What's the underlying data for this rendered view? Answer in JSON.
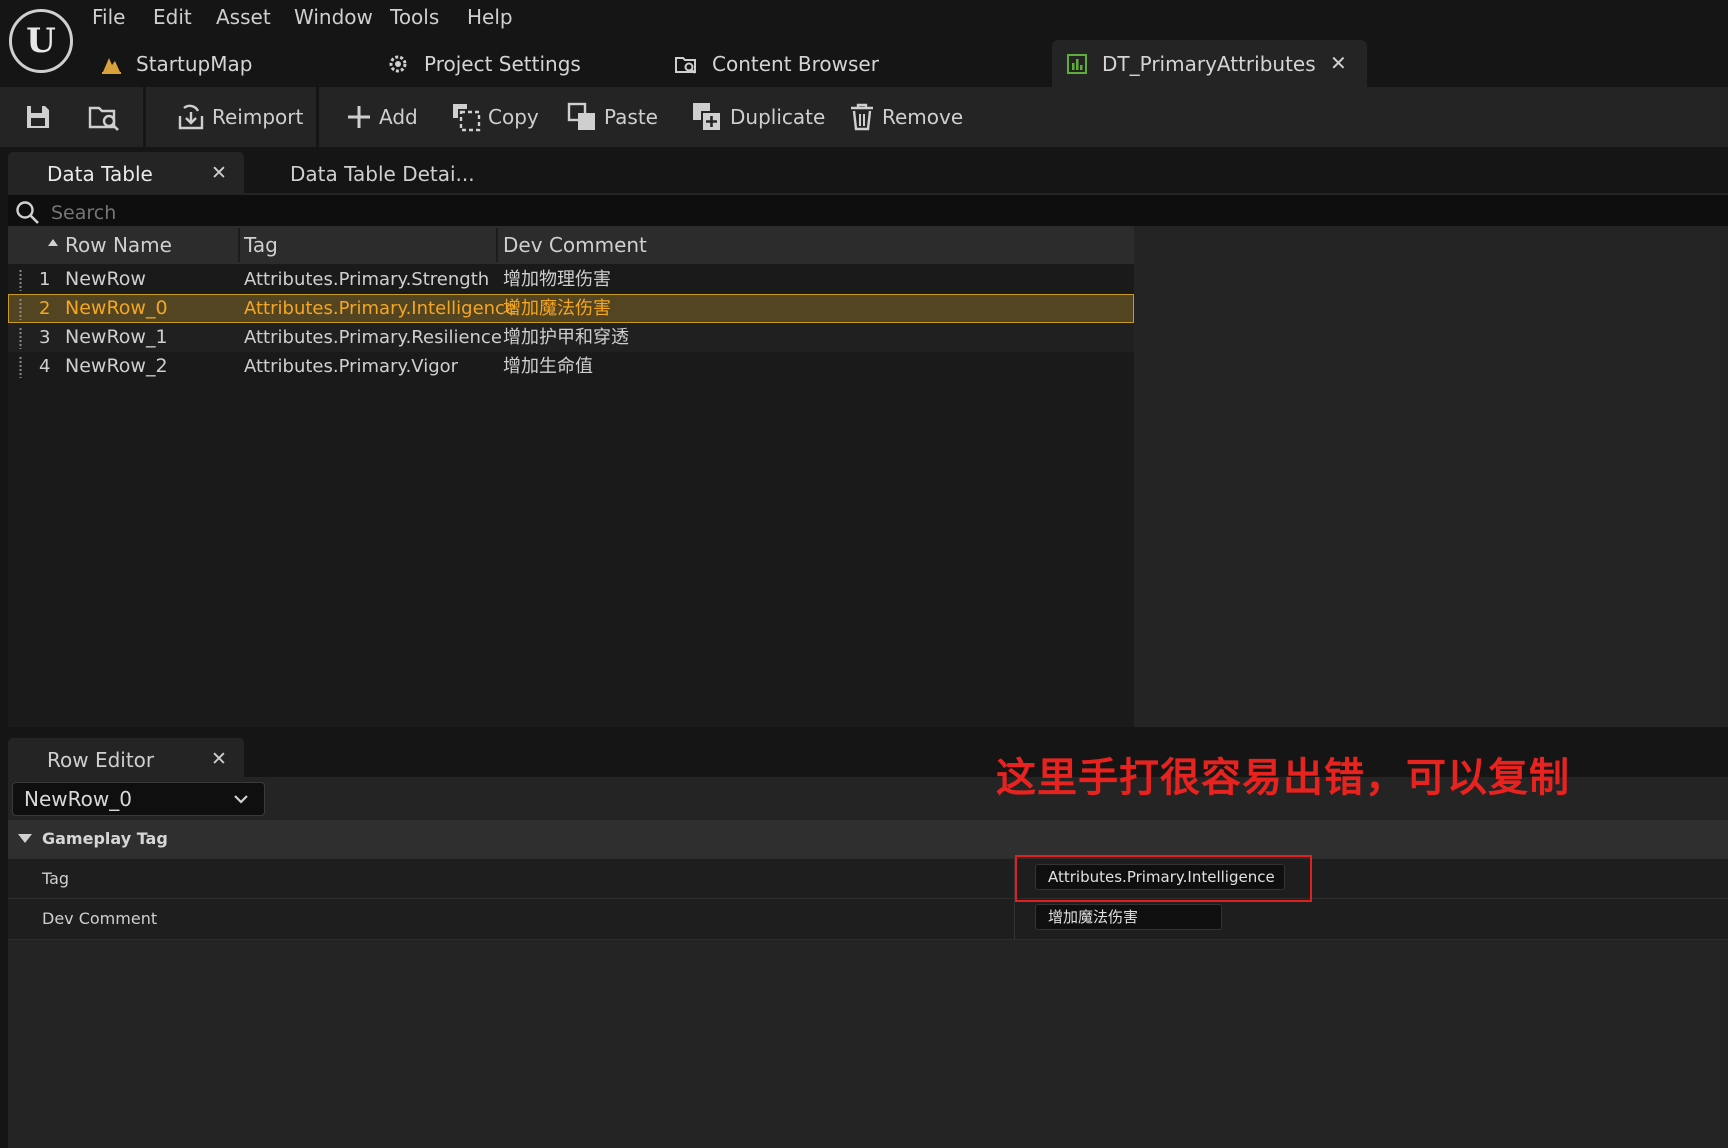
{
  "menu": [
    "File",
    "Edit",
    "Asset",
    "Window",
    "Tools",
    "Help"
  ],
  "doc_tabs": {
    "startup_map": "StartupMap",
    "project_settings": "Project Settings",
    "content_browser": "Content Browser",
    "data_table": "DT_PrimaryAttributes"
  },
  "toolbar": {
    "reimport": "Reimport",
    "add": "Add",
    "copy": "Copy",
    "paste": "Paste",
    "duplicate": "Duplicate",
    "remove": "Remove"
  },
  "panel_tabs": {
    "data_table": "Data Table",
    "data_table_details": "Data Table Detai...",
    "row_editor": "Row Editor"
  },
  "search": {
    "placeholder": "Search"
  },
  "table": {
    "columns": [
      "Row Name",
      "Tag",
      "Dev Comment"
    ],
    "rows": [
      {
        "index": "1",
        "name": "NewRow",
        "tag": "Attributes.Primary.Strength",
        "comment": "增加物理伤害"
      },
      {
        "index": "2",
        "name": "NewRow_0",
        "tag": "Attributes.Primary.Intelligence",
        "comment": "增加魔法伤害",
        "selected": true
      },
      {
        "index": "3",
        "name": "NewRow_1",
        "tag": "Attributes.Primary.Resilience",
        "comment": "增加护甲和穿透"
      },
      {
        "index": "4",
        "name": "NewRow_2",
        "tag": "Attributes.Primary.Vigor",
        "comment": "增加生命值"
      }
    ]
  },
  "row_editor": {
    "selected_row": "NewRow_0",
    "category": "Gameplay Tag",
    "properties": [
      {
        "label": "Tag",
        "value": "Attributes.Primary.Intelligence"
      },
      {
        "label": "Dev Comment",
        "value": "增加魔法伤害"
      }
    ]
  },
  "annotation": "这里手打很容易出错，可以复制",
  "colors": {
    "selection_text": "#f5a623",
    "annotation_red": "#e8231f",
    "tab_active_bg": "#242424"
  },
  "icons": [
    "unreal-logo-icon",
    "map-icon",
    "settings-icon",
    "content-browser-icon",
    "data-table-icon",
    "close-icon",
    "save-icon",
    "browse-icon",
    "reimport-icon",
    "add-icon",
    "copy-icon",
    "paste-icon",
    "duplicate-icon",
    "remove-icon",
    "search-icon",
    "sort-ascending-icon",
    "drag-handle-icon",
    "chevron-down-icon",
    "collapse-arrow-icon"
  ]
}
